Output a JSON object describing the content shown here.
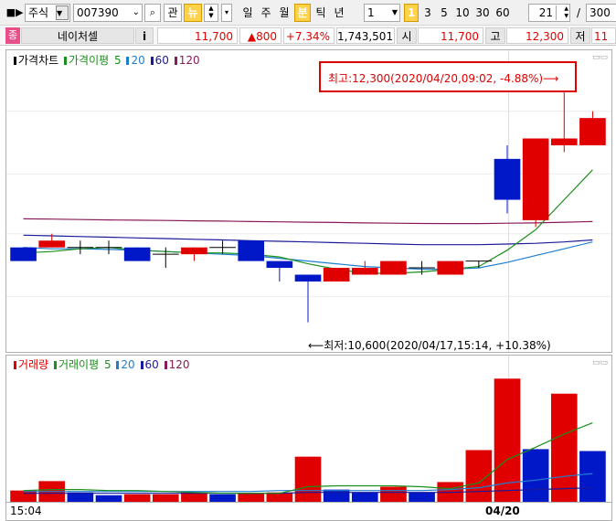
{
  "toolbar": {
    "market_select": "주식",
    "stock_code": "007390",
    "btn_gwan": "관",
    "btn_new": "뉴",
    "periods": [
      "일",
      "주",
      "월",
      "분",
      "틱",
      "년"
    ],
    "selected_period": "분",
    "interval_value": "1",
    "interval_shortcuts": [
      "1",
      "3",
      "5",
      "10",
      "30",
      "60"
    ],
    "selected_interval": "1",
    "count_value": "21",
    "slash": "/",
    "total_value": "300"
  },
  "info": {
    "badge": "종",
    "stock_name": "네이처셀",
    "info_button": "i",
    "price": "11,700",
    "change": "▲800",
    "change_pct": "+7.34%",
    "volume": "1,743,501",
    "open_label": "시",
    "open_value": "11,700",
    "high_label": "고",
    "high_value": "12,300",
    "low_label": "저",
    "low_value": "11"
  },
  "price_panel": {
    "legend": {
      "title": "가격차트",
      "ma_label": "가격이평",
      "periods": [
        "5",
        "20",
        "60",
        "120"
      ]
    },
    "high_annotation": "최고:12,300(2020/04/20,09:02, -4.88%)⟶",
    "low_annotation": "⟵최저:10,600(2020/04/17,15:14, +10.38%)"
  },
  "volume_panel": {
    "legend": {
      "title": "거래량",
      "ma_label": "거래이평",
      "periods": [
        "5",
        "20",
        "60",
        "120"
      ]
    }
  },
  "x_axis": {
    "labels": [
      "15:04",
      "04/20"
    ]
  },
  "colors": {
    "up": "#e00000",
    "down": "#0018c8",
    "ma5": "#1a8f1a",
    "ma20": "#1e7fd0",
    "ma60": "#1a1a9a",
    "ma120": "#8a1a5a",
    "selected_button": "#ffd24a"
  },
  "chart_data": {
    "type": "candlestick",
    "price_range": [
      10450,
      12450
    ],
    "candles": [
      {
        "o": 11150,
        "c": 11050,
        "h": 11150,
        "l": 11050
      },
      {
        "o": 11150,
        "c": 11200,
        "h": 11250,
        "l": 11150
      },
      {
        "o": 11150,
        "c": 11150,
        "h": 11200,
        "l": 11100
      },
      {
        "o": 11150,
        "c": 11150,
        "h": 11200,
        "l": 11100
      },
      {
        "o": 11150,
        "c": 11050,
        "h": 11150,
        "l": 11050
      },
      {
        "o": 11100,
        "c": 11100,
        "h": 11150,
        "l": 11000
      },
      {
        "o": 11100,
        "c": 11150,
        "h": 11150,
        "l": 11050
      },
      {
        "o": 11150,
        "c": 11150,
        "h": 11200,
        "l": 11100
      },
      {
        "o": 11200,
        "c": 11050,
        "h": 11200,
        "l": 11050
      },
      {
        "o": 11050,
        "c": 11000,
        "h": 11050,
        "l": 10900
      },
      {
        "o": 10950,
        "c": 10900,
        "h": 10950,
        "l": 10600
      },
      {
        "o": 10900,
        "c": 11000,
        "h": 11000,
        "l": 10900
      },
      {
        "o": 10950,
        "c": 11000,
        "h": 11050,
        "l": 10950
      },
      {
        "o": 10950,
        "c": 11050,
        "h": 11050,
        "l": 10950
      },
      {
        "o": 11000,
        "c": 11000,
        "h": 11050,
        "l": 10950
      },
      {
        "o": 10950,
        "c": 11050,
        "h": 11050,
        "l": 10950
      },
      {
        "o": 11050,
        "c": 11050,
        "h": 11050,
        "l": 11000
      },
      {
        "o": 11800,
        "c": 11500,
        "h": 11900,
        "l": 11400
      },
      {
        "o": 11350,
        "c": 11950,
        "h": 11950,
        "l": 11300
      },
      {
        "o": 11900,
        "c": 11950,
        "h": 12300,
        "l": 11850
      },
      {
        "o": 11900,
        "c": 12100,
        "h": 12150,
        "l": 11900
      }
    ],
    "ma5": [
      11110,
      11120,
      11140,
      11150,
      11130,
      11120,
      11110,
      11110,
      11100,
      11080,
      11030,
      10990,
      10960,
      10960,
      10970,
      10990,
      11010,
      11130,
      11280,
      11500,
      11720
    ],
    "ma20": [
      11150,
      11140,
      11140,
      11135,
      11130,
      11120,
      11110,
      11100,
      11090,
      11070,
      11050,
      11030,
      11010,
      11000,
      10990,
      10990,
      11000,
      11040,
      11090,
      11140,
      11190
    ],
    "ma60": [
      11240,
      11235,
      11230,
      11225,
      11220,
      11215,
      11210,
      11205,
      11200,
      11195,
      11190,
      11185,
      11180,
      11175,
      11170,
      11170,
      11170,
      11175,
      11180,
      11190,
      11205
    ],
    "ma120": [
      11360,
      11358,
      11355,
      11352,
      11350,
      11348,
      11345,
      11343,
      11340,
      11338,
      11335,
      11333,
      11330,
      11328,
      11326,
      11325,
      11325,
      11328,
      11330,
      11335,
      11340
    ],
    "volume": [
      {
        "v": 12,
        "up": true
      },
      {
        "v": 22,
        "up": true
      },
      {
        "v": 10,
        "up": false
      },
      {
        "v": 7,
        "up": false
      },
      {
        "v": 8,
        "up": true
      },
      {
        "v": 8,
        "up": true
      },
      {
        "v": 10,
        "up": true
      },
      {
        "v": 8,
        "up": false
      },
      {
        "v": 9,
        "up": true
      },
      {
        "v": 10,
        "up": true
      },
      {
        "v": 48,
        "up": true
      },
      {
        "v": 13,
        "up": false
      },
      {
        "v": 10,
        "up": false
      },
      {
        "v": 16,
        "up": true
      },
      {
        "v": 10,
        "up": false
      },
      {
        "v": 21,
        "up": true
      },
      {
        "v": 55,
        "up": true
      },
      {
        "v": 131,
        "up": true
      },
      {
        "v": 56,
        "up": false
      },
      {
        "v": 115,
        "up": true
      },
      {
        "v": 54,
        "up": false
      }
    ],
    "volume_max": 140,
    "vol_ma5": [
      12,
      13,
      13,
      12,
      12,
      11,
      10,
      9,
      9,
      9,
      16,
      17,
      17,
      17,
      16,
      14,
      20,
      45,
      58,
      72,
      84
    ],
    "vol_ma20": [
      11,
      11,
      11,
      11,
      11,
      11,
      11,
      11,
      11,
      12,
      12,
      12,
      12,
      12,
      12,
      13,
      15,
      20,
      23,
      27,
      30
    ],
    "vol_ma60": [
      9,
      9,
      9,
      9,
      9,
      9,
      9,
      9,
      9,
      9,
      10,
      10,
      10,
      10,
      10,
      10,
      11,
      12,
      13,
      14,
      15
    ]
  }
}
